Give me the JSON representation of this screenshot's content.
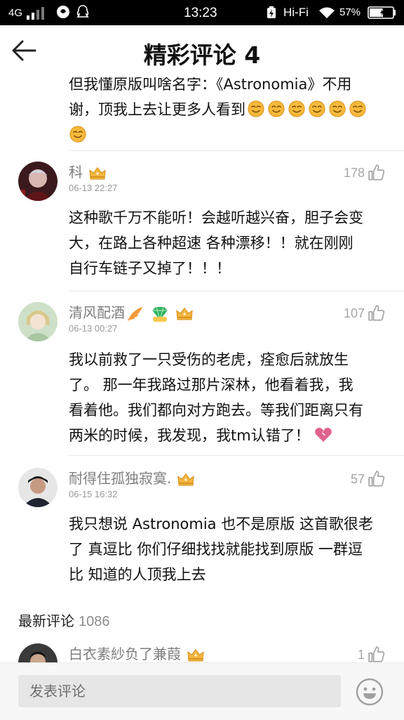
{
  "status_bar": {
    "network": "4G",
    "time": "13:23",
    "hifi": "Hi-Fi",
    "battery_percent": "57%"
  },
  "header": {
    "title": "精彩评论 4"
  },
  "partial_comment": {
    "line_1": "但我懂原版叫啥名字：《Astronomia》不用",
    "line_2": "谢，顶我上去让更多人看到"
  },
  "comments": [
    {
      "username": "科",
      "timestamp": "06-13 22:27",
      "likes": "178",
      "lines": [
        "这种歌千万不能听！会越听越兴奋，胆子会变",
        "大，在路上各种超速 各种漂移！！就在刚刚",
        "自行车链子又掉了！！！"
      ]
    },
    {
      "username": "清风配酒",
      "timestamp": "06-13 00:27",
      "likes": "107",
      "lines": [
        "我以前救了一只受伤的老虎，痊愈后就放生",
        "了。 那一年我路过那片深林，他看着我，我",
        "看着他。我们都向对方跑去。等我们距离只有",
        "两米的时候，我发现，我tm认错了！"
      ]
    },
    {
      "username": "耐得住孤独寂寞.",
      "timestamp": "06-15 16:32",
      "likes": "57",
      "lines": [
        "我只想说 Astronomia 也不是原版 这首歌很老",
        "了 真逗比 你们仔细找找就能找到原版 一群逗",
        "比 知道的人顶我上去"
      ]
    }
  ],
  "latest": {
    "title": "最新评论",
    "count": "1086",
    "first_username": "白衣素紗负了兼葭",
    "first_likes": "1"
  },
  "input": {
    "placeholder": "发表评论"
  },
  "colors": {
    "heart_broken": "#e0628f",
    "crown": "#f3b642",
    "emoji": "#f6b93b"
  }
}
